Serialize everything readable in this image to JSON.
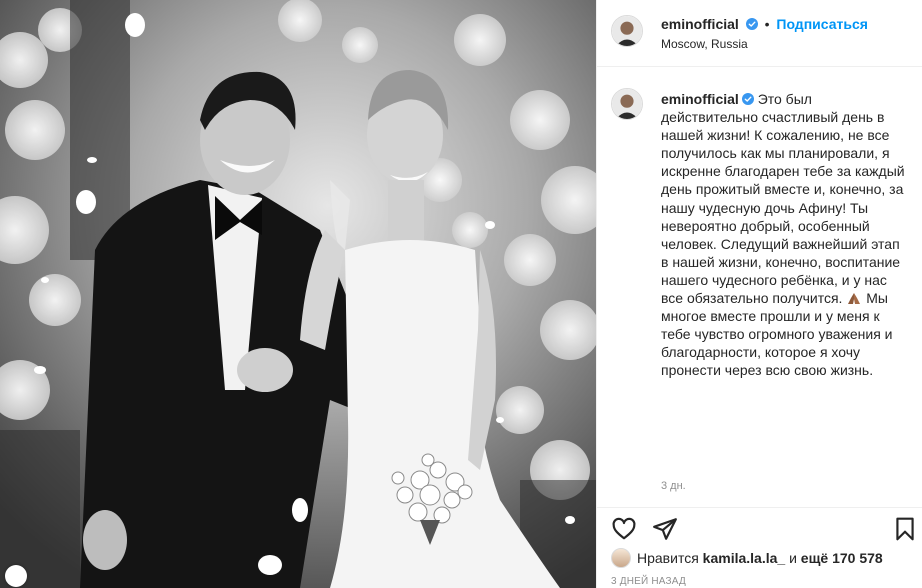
{
  "post": {
    "username": "eminofficial",
    "separator": "•",
    "follow_label": "Подписаться",
    "location": "Moscow, Russia",
    "caption_text": "Это был действительно счастливый день в нашей жизни! К сожалению, не все получилось как мы планировали, я искренне благодарен тебе за каждый день прожитый вместе и, конечно, за нашу чудесную дочь Афину! Ты невероятно добрый, особенный человек. Следущий важнейший этап в нашей жизни, конечно, воспитание нашего чудесного ребёнка, и у нас все обязательно получится.",
    "caption_text_2": "Мы многое вместе прошли и у меня к тебе чувство огромного уважения и благодарности, которое я хочу пронести через всю свою жизнь.",
    "caption_age": "3 дн.",
    "likes_prefix": "Нравится",
    "likes_user": "kamila.la.la_",
    "likes_middle": "и",
    "likes_count": "ещё 170 578",
    "posted_ago": "3 ДНЕЙ НАЗАД"
  },
  "icons": {
    "verified": "verified-badge-icon",
    "like": "heart-icon",
    "share": "paper-plane-icon",
    "save": "bookmark-icon",
    "pray": "praying-hands-emoji"
  },
  "colors": {
    "follow": "#0095f6",
    "verified": "#3897f0",
    "secondary_text": "#8e8e8e"
  }
}
